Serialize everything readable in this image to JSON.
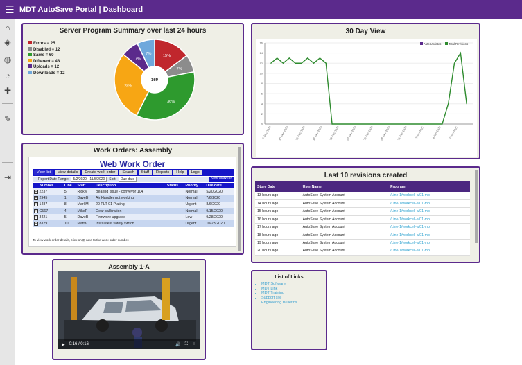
{
  "topbar": {
    "title": "MDT AutoSave Portal | Dashboard",
    "menu_icon": "hamburger-icon"
  },
  "sidebar": {
    "icons": [
      "home-icon",
      "layers-icon",
      "globe-icon",
      "compass-icon",
      "puzzle-icon",
      "edit-icon",
      "logout-icon"
    ]
  },
  "summary": {
    "title": "Server Program Summary over last 24 hours",
    "total": "169",
    "legend": [
      {
        "label": "Errors = 25",
        "color": "#c0272d"
      },
      {
        "label": "Disabled = 12",
        "color": "#8c8c8c"
      },
      {
        "label": "Same = 60",
        "color": "#2e9a2e"
      },
      {
        "label": "Different = 48",
        "color": "#f7a614"
      },
      {
        "label": "Uploads = 12",
        "color": "#5b2a8c"
      },
      {
        "label": "Downloads = 12",
        "color": "#6fa8dc"
      }
    ],
    "slice_labels": [
      "15%",
      "7%",
      "36%",
      "28%",
      "7%",
      "7%"
    ]
  },
  "chart_data": {
    "type": "line",
    "title": "30 Day View",
    "legend": [
      "Auto Updates",
      "Total Revisions"
    ],
    "legend_colors": [
      "#5b2a8c",
      "#2e8b2e"
    ],
    "yticks": [
      "0",
      "2",
      "4",
      "6",
      "8",
      "10",
      "12",
      "14",
      "16"
    ],
    "ylim": [
      0,
      16
    ],
    "categories": [
      "7-Dec-2020",
      "10-Dec-2020",
      "13-Dec-2020",
      "16-Dec-2020",
      "19-Dec-2020",
      "22-Dec-2020",
      "25-Dec-2020",
      "28-Dec-2020",
      "31-Dec-2020",
      "3-Jan-2021",
      "6-Jan-2021",
      "9-Jan-2021"
    ],
    "series": [
      {
        "name": "Total Revisions",
        "points": [
          [
            1,
            12
          ],
          [
            2,
            13
          ],
          [
            3,
            12
          ],
          [
            4,
            13
          ],
          [
            5,
            12
          ],
          [
            6,
            12
          ],
          [
            7,
            13
          ],
          [
            8,
            12
          ],
          [
            9,
            13
          ],
          [
            10,
            12
          ],
          [
            11,
            0
          ],
          [
            29,
            0
          ],
          [
            30,
            4
          ],
          [
            31,
            12
          ],
          [
            32,
            14
          ],
          [
            33,
            4
          ]
        ]
      }
    ],
    "xmax": 34
  },
  "workorders": {
    "panel_title": "Work Orders: Assembly",
    "app_title": "Web Work Order",
    "toolbar": [
      "View list",
      "View details",
      "Create work order",
      "Search",
      "Staff",
      "Reports",
      "Help",
      "Logo"
    ],
    "filter": {
      "label": "Report Date Range:",
      "range": "5/2/2020 - 11/5/2020",
      "sort_label": "Sort:",
      "sort_value": "Due date",
      "new_button": "New Work Or"
    },
    "columns": [
      "Number",
      "Line",
      "Staff",
      "Description",
      "Status",
      "Priority",
      "Due date"
    ],
    "rows": [
      [
        "2237",
        "5",
        "RickM",
        "Bearing issue - conveyor 104",
        "",
        "Normal",
        "5/20/2020"
      ],
      [
        "2945",
        "1",
        "DaveB",
        "Air Handler not working",
        "",
        "Normal",
        "7/6/2020"
      ],
      [
        "1487",
        "8",
        "MarkM",
        "20 PLT-01 Plating",
        "",
        "Urgent",
        "8/6/2020"
      ],
      [
        "C567",
        "4",
        "MikeP",
        "Gear calibration",
        "",
        "Normal",
        "9/15/2020"
      ],
      [
        "3421",
        "5",
        "DaveB",
        "Firmware upgrade",
        "",
        "Low",
        "9/28/2020"
      ],
      [
        "8329",
        "10",
        "MattK",
        "Install/test safety switch",
        "",
        "Urgent",
        "10/23/2020"
      ]
    ],
    "footnote": "To view work order details, click on ⊞ next to the work order number."
  },
  "revisions": {
    "title": "Last 10 revisions created",
    "columns": [
      "Store Date",
      "User Name",
      "Program"
    ],
    "rows": [
      [
        "13 hours ago",
        "AutoSave System Account",
        "/Line-1/workcell-a/01-mb"
      ],
      [
        "14 hours ago",
        "AutoSave System Account",
        "/Line-1/workcell-a/01-mb"
      ],
      [
        "15 hours ago",
        "AutoSave System Account",
        "/Line-1/workcell-a/01-mb"
      ],
      [
        "16 hours ago",
        "AutoSave System Account",
        "/Line-1/workcell-a/01-mb"
      ],
      [
        "17 hours ago",
        "AutoSave System Account",
        "/Line-1/workcell-a/01-mb"
      ],
      [
        "18 hours ago",
        "AutoSave System Account",
        "/Line-1/workcell-a/01-mb"
      ],
      [
        "19 hours ago",
        "AutoSave System Account",
        "/Line-1/workcell-a/01-mb"
      ],
      [
        "20 hours ago",
        "AutoSave System Account",
        "/Line-1/workcell-a/01-mb"
      ]
    ]
  },
  "assembly": {
    "title": "Assembly 1-A",
    "time": "0:16 / 0:16"
  },
  "links": {
    "title": "List of Links",
    "items": [
      "MDT Software",
      "MDT Link",
      "MDT Training",
      "Support site",
      "Engineering Bulletins"
    ]
  }
}
